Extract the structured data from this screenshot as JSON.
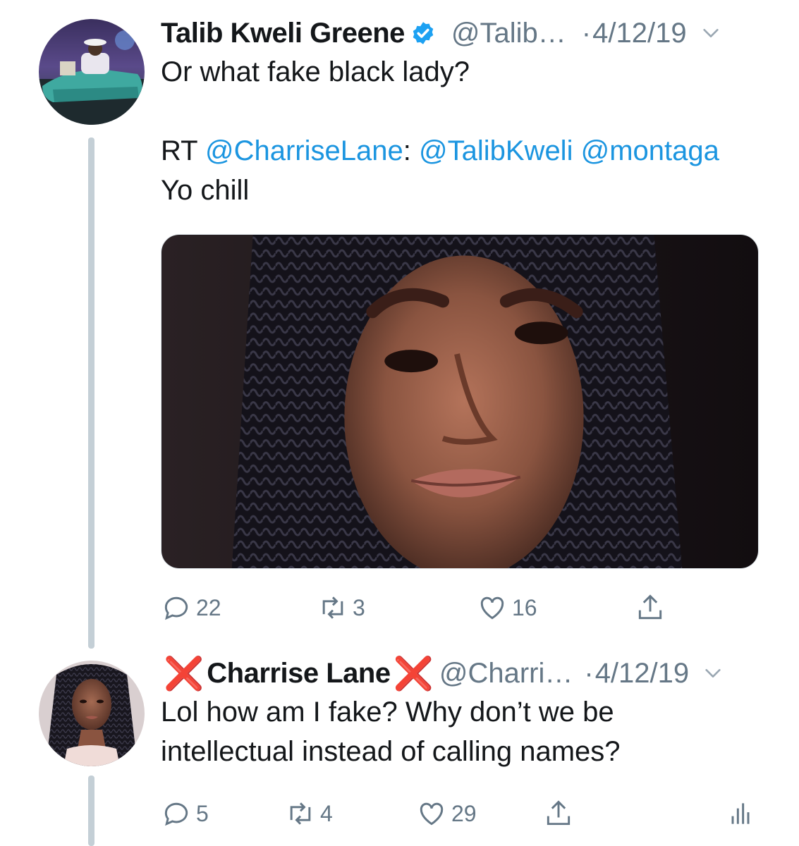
{
  "tweets": [
    {
      "name": "Talib Kweli Greene",
      "handle": "@Talib…",
      "date": "4/12/19",
      "dot": "·",
      "text_line1": "Or what fake black lady?",
      "rt_prefix": "RT",
      "rt_mention1": "@CharriseLane",
      "rt_colon": ":",
      "rt_mention2": "@TalibKweli",
      "rt_mention3": "@montaga",
      "rt_text": "Yo chill",
      "replies": "22",
      "retweets": "3",
      "likes": "16"
    },
    {
      "name_prefix_mark": "❌",
      "name": "Charrise Lane",
      "name_suffix_mark": "❌",
      "handle": "@Charri…",
      "date": "4/12/19",
      "dot": "·",
      "text_line1": "Lol how am I fake? Why don’t we be",
      "text_line2": "intellectual instead of calling names?",
      "replies": "5",
      "retweets": "4",
      "likes": "29"
    }
  ],
  "colors": {
    "link": "#1b95e0",
    "secondary": "#657786",
    "thread_line": "#c4cfd6",
    "verified": "#1da1f2",
    "x_mark": "#e0201a"
  },
  "icons": [
    "reply-icon",
    "retweet-icon",
    "like-icon",
    "share-icon",
    "analytics-icon",
    "verified-icon",
    "chevron-down-icon"
  ]
}
